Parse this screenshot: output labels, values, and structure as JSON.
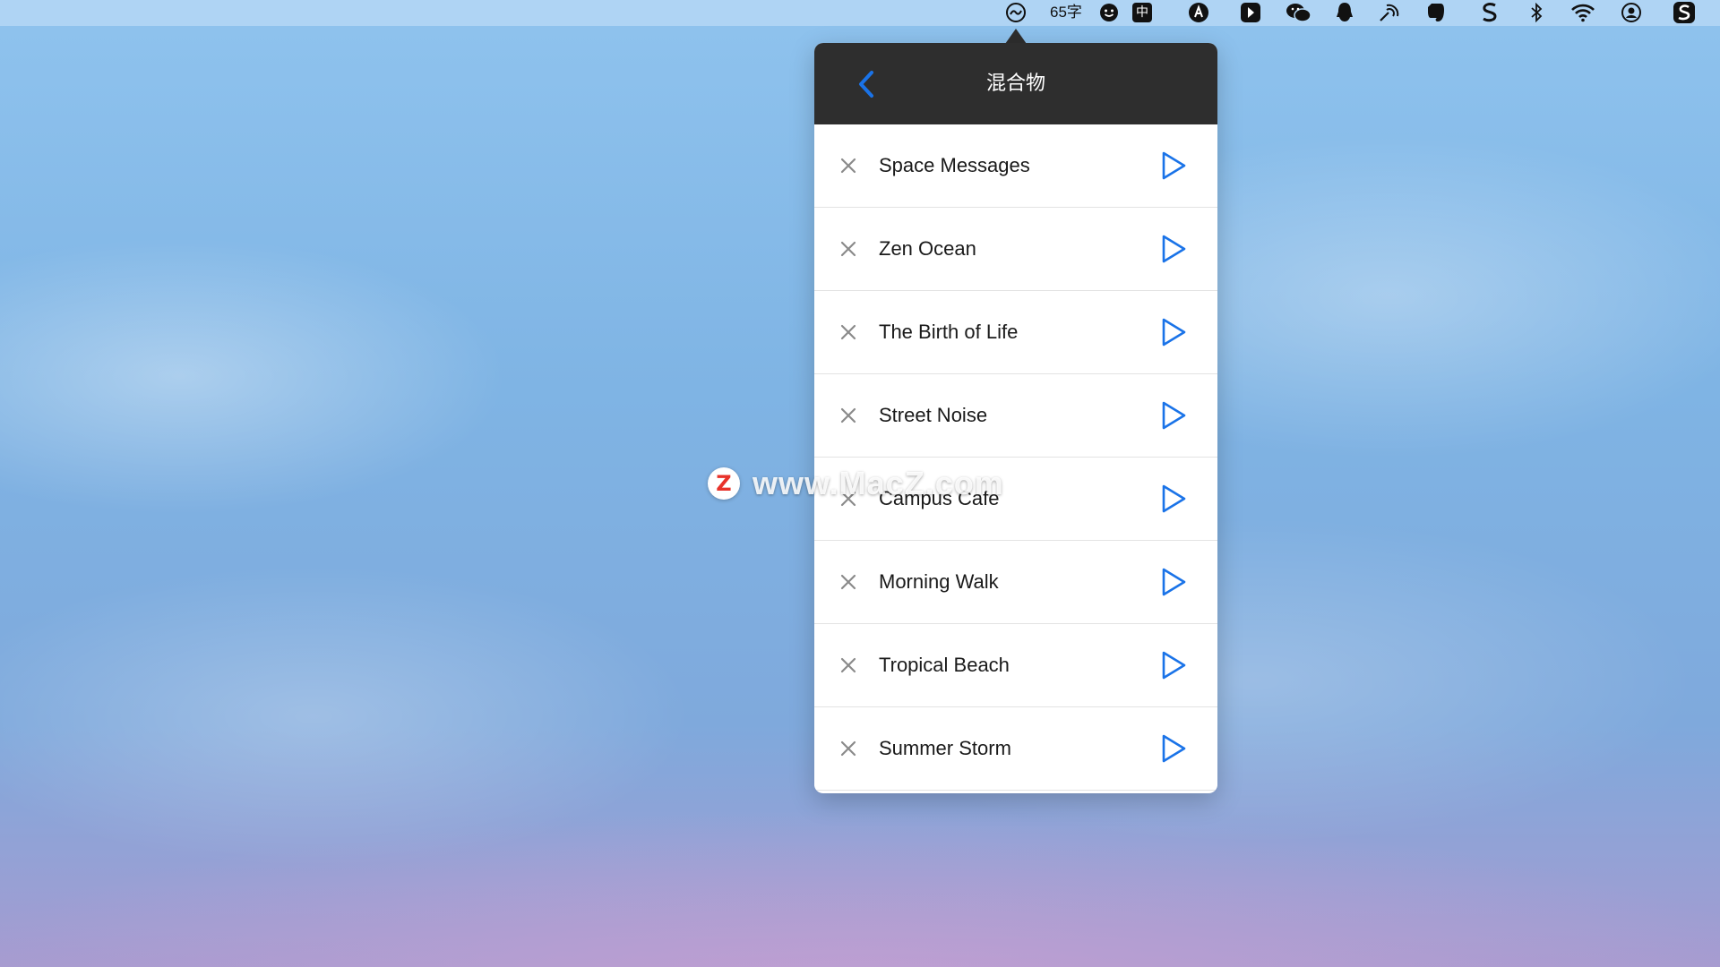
{
  "menubar": {
    "icons": [
      "mixing-app-icon",
      "smiley-icon",
      "bitwarden-icon",
      "arrow-app-icon",
      "wechat-icon",
      "qq-icon",
      "broadcast-icon",
      "evernote-icon",
      "scrivener-icon",
      "bluetooth-icon",
      "wifi-icon",
      "user-account-icon",
      "s-app-icon"
    ],
    "word_count": "65字",
    "input_method": "中"
  },
  "popover": {
    "title": "混合物",
    "back_icon": "chevron-left-icon",
    "accent_color": "#1a73e8",
    "header_color": "#2e2e2e",
    "items": [
      {
        "name": "Space Messages"
      },
      {
        "name": "Zen Ocean"
      },
      {
        "name": "The Birth of Life"
      },
      {
        "name": "Street Noise"
      },
      {
        "name": "Campus Cafe"
      },
      {
        "name": "Morning Walk"
      },
      {
        "name": "Tropical Beach"
      },
      {
        "name": "Summer Storm"
      }
    ]
  },
  "watermark": {
    "logo_letter": "Z",
    "text": "www.MacZ.com"
  }
}
